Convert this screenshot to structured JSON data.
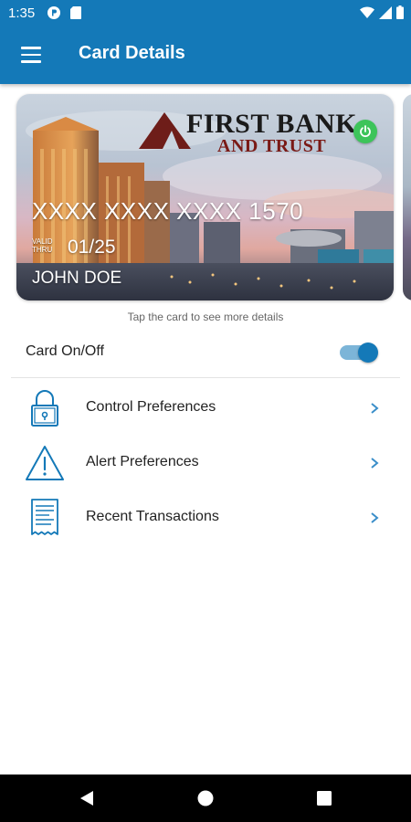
{
  "status_bar": {
    "time": "1:35",
    "icons": [
      "p-logo-icon",
      "sd-card-icon",
      "wifi-icon",
      "cell-signal-icon",
      "battery-icon"
    ]
  },
  "app_bar": {
    "title": "Card Details",
    "menu_icon": "hamburger-menu-icon",
    "color": "#1479b8"
  },
  "card": {
    "bank_name_line1": "FIRST BANK",
    "bank_name_line2": "AND TRUST",
    "number": "XXXX XXXX XXXX 1570",
    "valid_thru_label": "VALID THRU",
    "expiry": "01/25",
    "holder": "JOHN DOE",
    "status_icon": "power-icon",
    "status_color": "#3dc45a"
  },
  "hint": "Tap the card to see more details",
  "card_toggle": {
    "label": "Card On/Off",
    "state": "on",
    "accent": "#1479b8"
  },
  "menu_items": [
    {
      "label": "Control Preferences",
      "icon": "padlock-icon"
    },
    {
      "label": "Alert Preferences",
      "icon": "warning-triangle-icon"
    },
    {
      "label": "Recent Transactions",
      "icon": "receipt-icon"
    }
  ],
  "nav_bar": {
    "buttons": [
      "back-icon",
      "home-icon",
      "recents-icon"
    ]
  }
}
